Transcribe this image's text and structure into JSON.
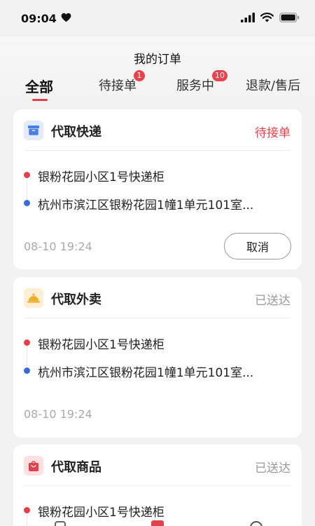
{
  "status_bar": {
    "time": "09:04"
  },
  "header": {
    "title": "我的订单"
  },
  "tabs": [
    {
      "label": "全部",
      "active": true
    },
    {
      "label": "待接单",
      "badge": "1"
    },
    {
      "label": "服务中",
      "badge": "10"
    },
    {
      "label": "退款/售后"
    }
  ],
  "orders": [
    {
      "title": "代取快递",
      "icon": "box-icon",
      "status": "待接单",
      "status_color": "#e0414b",
      "pickup": "银粉花园小区1号快递柜",
      "delivery": "杭州市滨江区银粉花园1幢1单元101室...",
      "time": "08-10 19:24",
      "action": "取消"
    },
    {
      "title": "代取外卖",
      "icon": "food-cover-icon",
      "status": "已送达",
      "status_color": "#999999",
      "pickup": "银粉花园小区1号快递柜",
      "delivery": "杭州市滨江区银粉花园1幢1单元101室...",
      "time": "08-10 19:24"
    },
    {
      "title": "代取商品",
      "icon": "shopping-bag-icon",
      "status": "已送达",
      "status_color": "#999999",
      "pickup": "银粉花园小区1号快递柜"
    }
  ],
  "colors": {
    "accent": "#e0414b",
    "blue": "#3a6cd6"
  }
}
